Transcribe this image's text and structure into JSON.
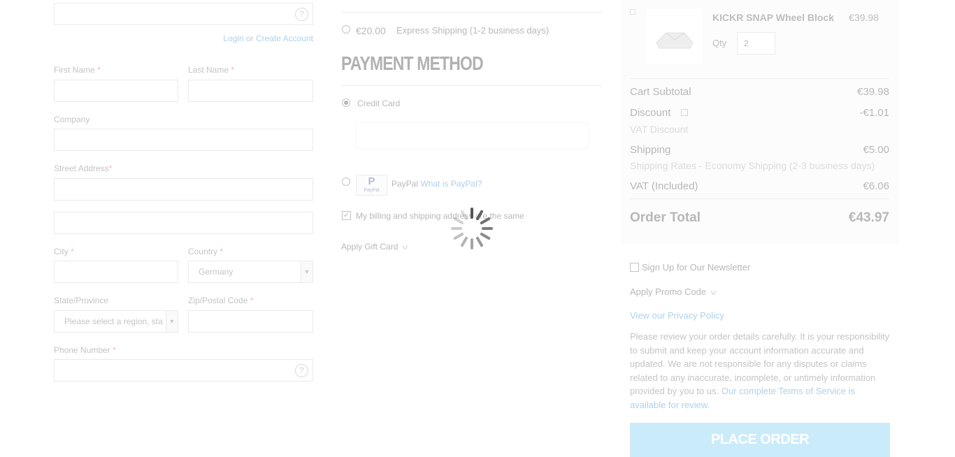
{
  "left": {
    "login_link": "Login or Create Account",
    "help_glyph": "?",
    "first_name_label": "First Name",
    "last_name_label": "Last Name",
    "company_label": "Company",
    "street_label": "Street Address",
    "city_label": "City",
    "country_label": "Country",
    "country_value": "Germany",
    "state_label": "State/Province",
    "state_placeholder": "Please select a region, sta",
    "zip_label": "Zip/Postal Code",
    "phone_label": "Phone Number",
    "required_mark": "*"
  },
  "shipping": {
    "price": "€20.00",
    "method": "Express Shipping (1-2 business days)"
  },
  "payment": {
    "title": "PAYMENT METHOD",
    "credit_card": "Credit Card",
    "paypal": "PayPal",
    "paypal_logo_text": "P",
    "paypal_logo_small": "PayPal",
    "what_is_paypal": "What is PayPal?",
    "billing_same": "My billing and shipping address are the same",
    "gift_card": "Apply Gift Card"
  },
  "summary": {
    "product_name": "KICKR SNAP Wheel Block",
    "product_price": "€39.98",
    "qty_label": "Qty",
    "qty_value": "2",
    "cart_subtotal_label": "Cart Subtotal",
    "cart_subtotal": "€39.98",
    "discount_label": "Discount",
    "discount": "-€1.01",
    "vat_discount": "VAT Discount",
    "shipping_label": "Shipping",
    "shipping": "€5.00",
    "shipping_rates": "Shipping Rates - Economy Shipping (2-3 business days)",
    "vat_label": "VAT (Included)",
    "vat": "€6.06",
    "order_total_label": "Order Total",
    "order_total": "€43.97"
  },
  "right": {
    "newsletter": "Sign Up for Our Newsletter",
    "promo": "Apply Promo Code",
    "privacy": "View our Privacy Policy",
    "terms_text": "Please review your order details carefully. It is your responsibility to submit and keep your account information accurate and updated. We are not responsible for any disputes or claims related to any inaccurate, incomplete, or untimely information provided by you to us.",
    "terms_link": "Our complete Terms of Service is available for review.",
    "place_order": "PLACE ORDER"
  },
  "colors": {
    "accent": "#1979c3",
    "place_order_bg": "#69c8f0",
    "required": "#e02b27"
  }
}
